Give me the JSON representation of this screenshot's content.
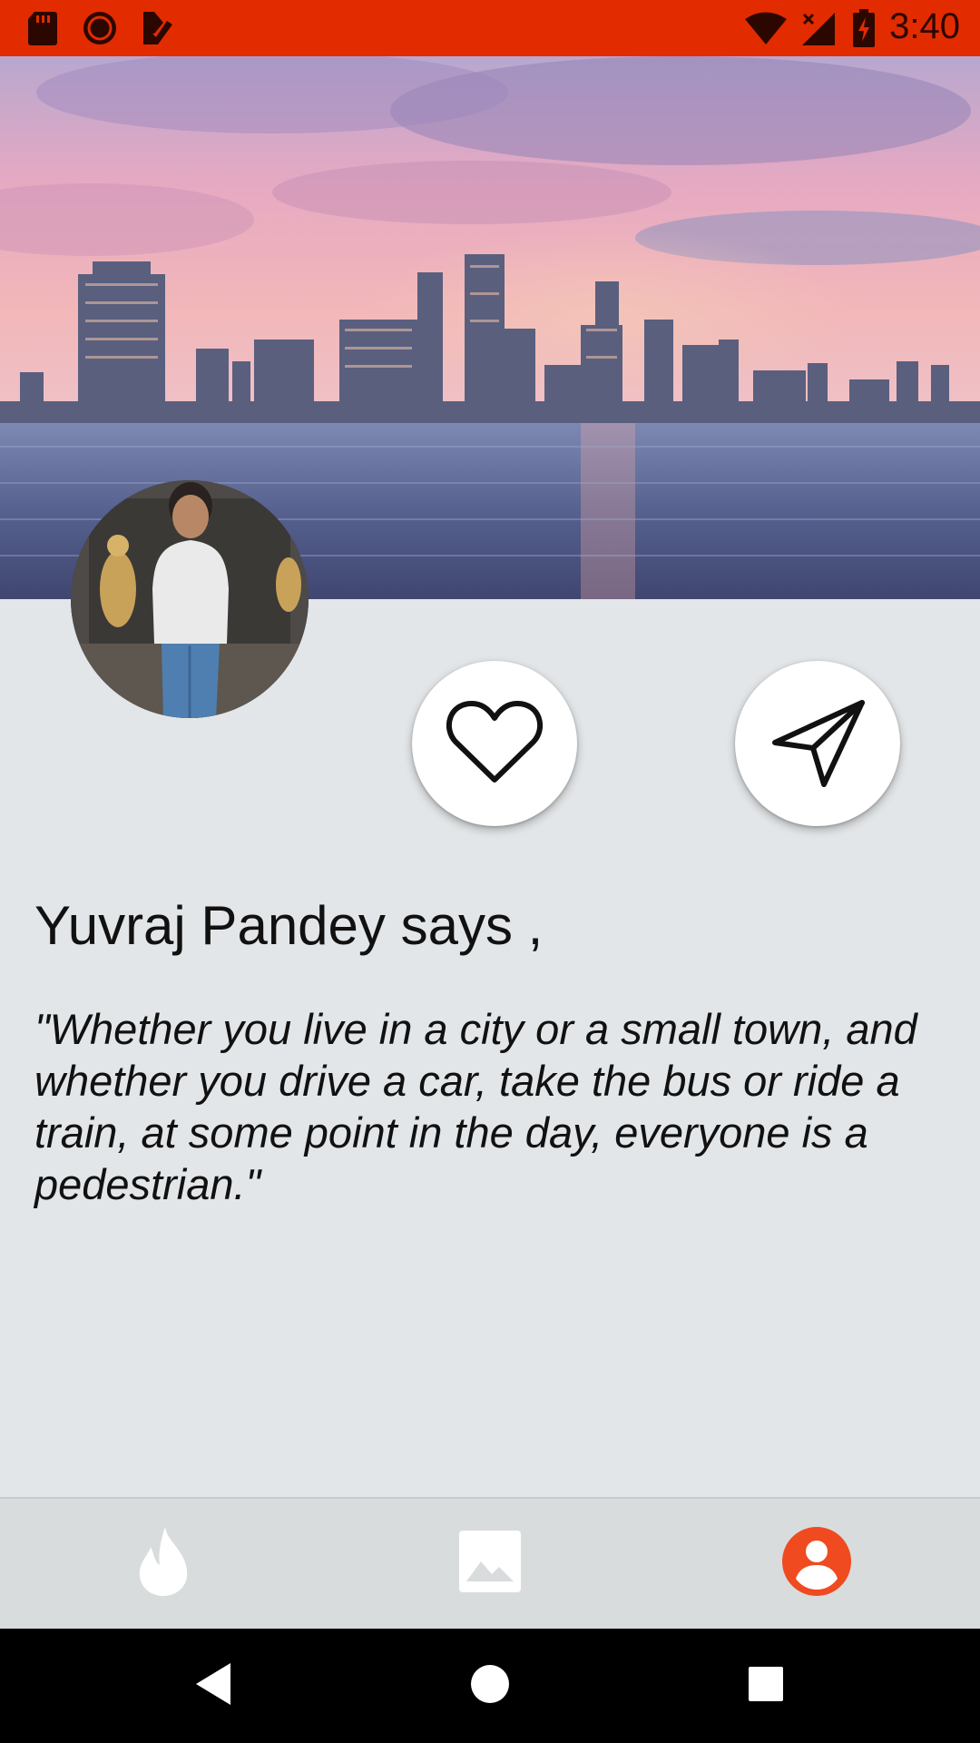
{
  "status_bar": {
    "time": "3:40",
    "background_color": "#e32b00",
    "left_icons": [
      "sd-card-icon",
      "circle-icon",
      "download-check-icon"
    ],
    "right_icons": [
      "wifi-icon",
      "cell-signal-icon",
      "battery-charging-icon"
    ]
  },
  "hero": {
    "image": "city-skyline-waterfront-sunset"
  },
  "profile": {
    "avatar_image": "avatar-photo"
  },
  "actions": {
    "like_icon": "heart-outline-icon",
    "share_icon": "send-paper-plane-icon"
  },
  "post": {
    "author_line": "Yuvraj Pandey says ,",
    "quote": "\"Whether you live in a city or a small town, and whether you drive a car, take the bus or ride a train, at some point in the day, everyone is a pedestrian.\""
  },
  "bottom_nav": {
    "items": [
      {
        "icon": "flame-icon",
        "active": false
      },
      {
        "icon": "image-icon",
        "active": false
      },
      {
        "icon": "account-circle-icon",
        "active": true
      }
    ],
    "active_color": "#f04a20",
    "inactive_color": "#ffffff"
  },
  "system_nav": {
    "buttons": [
      "back-icon",
      "home-icon",
      "recents-icon"
    ]
  }
}
